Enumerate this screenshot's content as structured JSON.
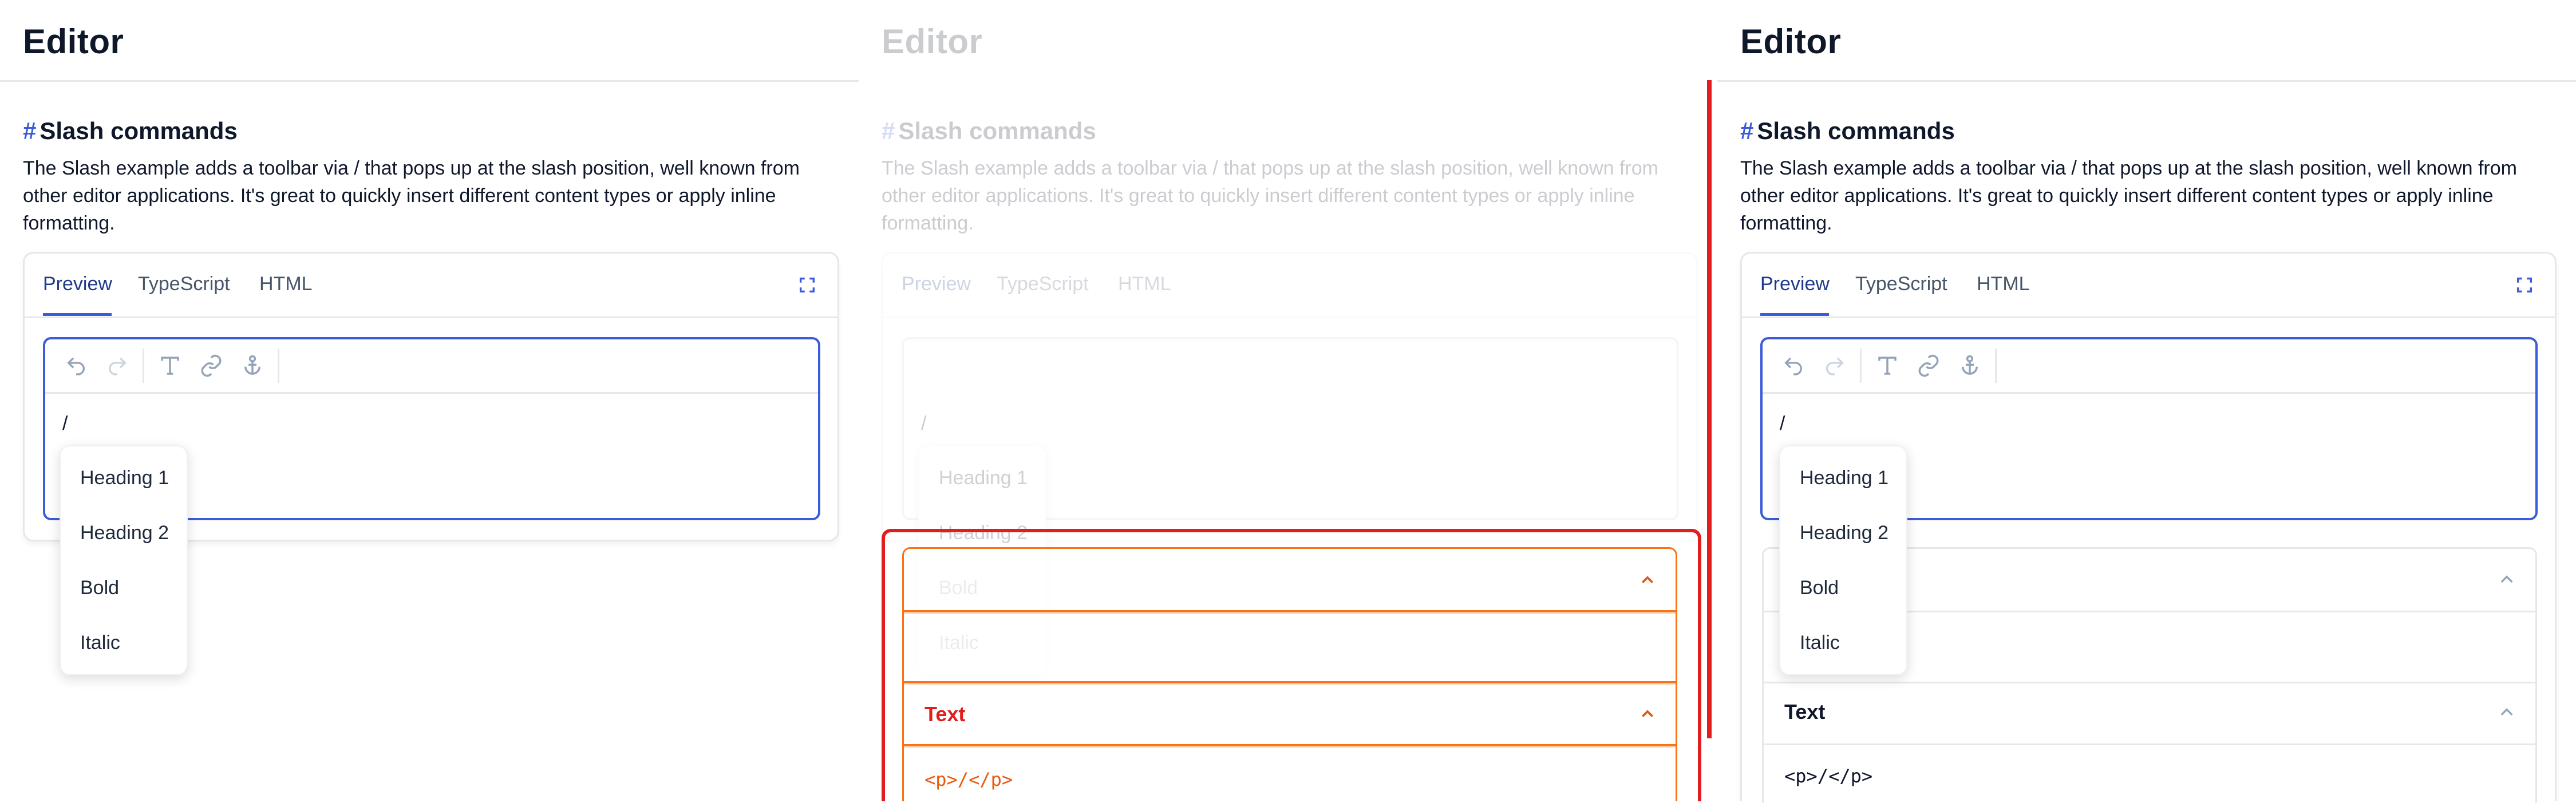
{
  "app": {
    "title": "Editor"
  },
  "section": {
    "hash": "#",
    "title": "Slash commands",
    "description": "The Slash example adds a toolbar via / that pops up at the slash position, well known from other editor applications. It's great to quickly insert different content types or apply inline formatting."
  },
  "tabs": [
    {
      "label": "Preview",
      "active": true
    },
    {
      "label": "TypeScript",
      "active": false
    },
    {
      "label": "HTML",
      "active": false
    }
  ],
  "toolbar": {
    "icons": [
      "undo-icon",
      "redo-icon",
      "text-format-icon",
      "link-icon",
      "anchor-icon"
    ]
  },
  "editor": {
    "content": "/"
  },
  "slash_menu": {
    "items": [
      "Heading 1",
      "Heading 2",
      "Bold",
      "Italic"
    ]
  },
  "code_panel": {
    "text_section_title": "Text",
    "text_section_code": "<p>/</p>"
  },
  "colors": {
    "accent": "#3b5bdb",
    "highlight_red": "#e11d1d",
    "highlight_orange": "#f97316",
    "text_heading": "#0f172a"
  }
}
